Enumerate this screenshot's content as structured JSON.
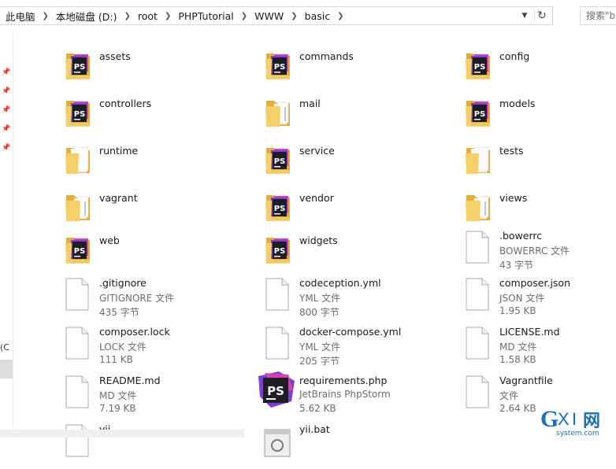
{
  "address_bar": {
    "crumbs": [
      "此电脑",
      "本地磁盘 (D:)",
      "root",
      "PHPTutorial",
      "WWW",
      "basic"
    ],
    "search_placeholder": "搜索\"b"
  },
  "nav_pane": {
    "partial_label": "(C"
  },
  "items": [
    {
      "name": "assets",
      "kind": "folder-ps"
    },
    {
      "name": "commands",
      "kind": "folder-ps"
    },
    {
      "name": "config",
      "kind": "folder-ps"
    },
    {
      "name": "controllers",
      "kind": "folder-ps"
    },
    {
      "name": "mail",
      "kind": "folder"
    },
    {
      "name": "models",
      "kind": "folder-ps"
    },
    {
      "name": "runtime",
      "kind": "folder-empty"
    },
    {
      "name": "service",
      "kind": "folder-ps"
    },
    {
      "name": "tests",
      "kind": "folder-empty"
    },
    {
      "name": "vagrant",
      "kind": "folder"
    },
    {
      "name": "vendor",
      "kind": "folder-ps"
    },
    {
      "name": "views",
      "kind": "folder"
    },
    {
      "name": "web",
      "kind": "folder-ps"
    },
    {
      "name": "widgets",
      "kind": "folder-ps"
    },
    {
      "name": ".bowerrc",
      "kind": "file",
      "type": "BOWERRC 文件",
      "size": "43 字节"
    },
    {
      "name": ".gitignore",
      "kind": "file",
      "type": "GITIGNORE 文件",
      "size": "435 字节"
    },
    {
      "name": "codeception.yml",
      "kind": "file",
      "type": "YML 文件",
      "size": "800 字节"
    },
    {
      "name": "composer.json",
      "kind": "file",
      "type": "JSON 文件",
      "size": "1.95 KB"
    },
    {
      "name": "composer.lock",
      "kind": "file",
      "type": "LOCK 文件",
      "size": "111 KB"
    },
    {
      "name": "docker-compose.yml",
      "kind": "file",
      "type": "YML 文件",
      "size": "205 字节"
    },
    {
      "name": "LICENSE.md",
      "kind": "file",
      "type": "MD 文件",
      "size": "1.58 KB"
    },
    {
      "name": "README.md",
      "kind": "file",
      "type": "MD 文件",
      "size": "7.19 KB"
    },
    {
      "name": "requirements.php",
      "kind": "phpstorm",
      "type": "JetBrains PhpStorm",
      "size": "5.62 KB"
    },
    {
      "name": "Vagrantfile",
      "kind": "file",
      "type": "文件",
      "size": "2.64 KB"
    },
    {
      "name": "yii",
      "kind": "file"
    },
    {
      "name": "yii.bat",
      "kind": "bat"
    }
  ],
  "icon_glyph": "PS",
  "watermark": {
    "brand": "GXI网",
    "domain": "system.com"
  },
  "colors": {
    "folder": "#f4cf6a",
    "folder_dark": "#e2ae3c",
    "ps_dark": "#1d1d24",
    "ps_pink": "#d63fb4",
    "ps_purple": "#7b3fd6",
    "watermark": "#1a6fb5"
  }
}
